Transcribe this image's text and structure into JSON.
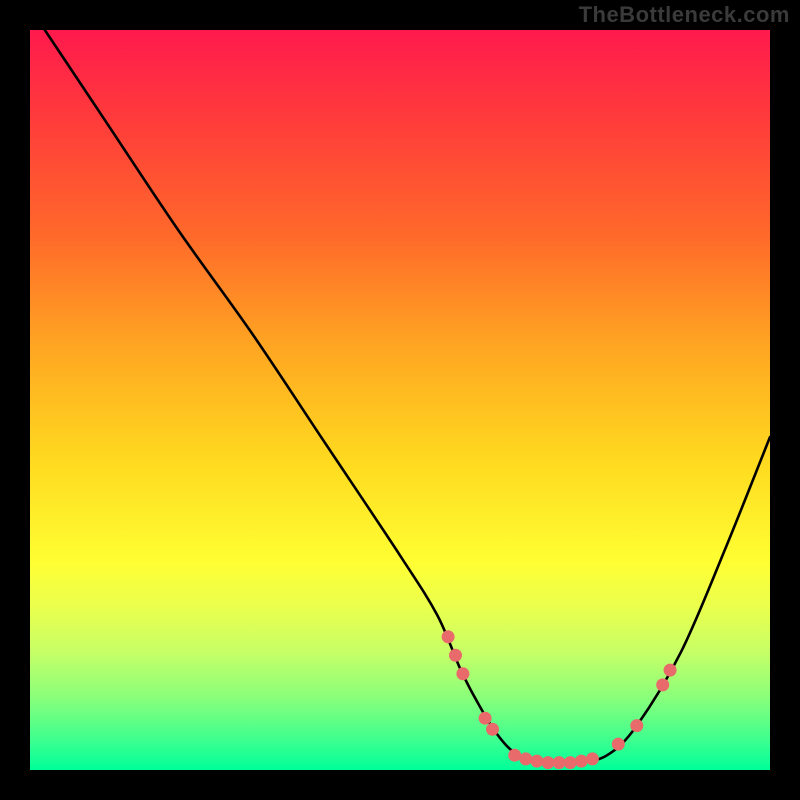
{
  "watermark": "TheBottleneck.com",
  "colors": {
    "frame_bg": "#000000",
    "gradient_top": "#ff1a4d",
    "gradient_bottom": "#00ff99",
    "curve_stroke": "#000000",
    "point_fill": "#e86a6a"
  },
  "chart_data": {
    "type": "line",
    "title": "",
    "xlabel": "",
    "ylabel": "",
    "xlim": [
      0,
      100
    ],
    "ylim": [
      0,
      100
    ],
    "grid": false,
    "legend": false,
    "series": [
      {
        "name": "curve",
        "x": [
          2,
          10,
          20,
          30,
          40,
          50,
          55,
          58,
          60,
          63,
          66,
          70,
          74,
          78,
          82,
          88,
          94,
          100
        ],
        "y": [
          100,
          88,
          73,
          59,
          44,
          29,
          21,
          14,
          10,
          5,
          2,
          1,
          1,
          2,
          6,
          16,
          30,
          45
        ]
      }
    ],
    "points": [
      {
        "x": 56.5,
        "y": 18
      },
      {
        "x": 57.5,
        "y": 15.5
      },
      {
        "x": 58.5,
        "y": 13
      },
      {
        "x": 61.5,
        "y": 7
      },
      {
        "x": 62.5,
        "y": 5.5
      },
      {
        "x": 65.5,
        "y": 2
      },
      {
        "x": 67,
        "y": 1.5
      },
      {
        "x": 68.5,
        "y": 1.2
      },
      {
        "x": 70,
        "y": 1
      },
      {
        "x": 71.5,
        "y": 1
      },
      {
        "x": 73,
        "y": 1
      },
      {
        "x": 74.5,
        "y": 1.2
      },
      {
        "x": 76,
        "y": 1.5
      },
      {
        "x": 79.5,
        "y": 3.5
      },
      {
        "x": 82,
        "y": 6
      },
      {
        "x": 85.5,
        "y": 11.5
      },
      {
        "x": 86.5,
        "y": 13.5
      }
    ]
  }
}
